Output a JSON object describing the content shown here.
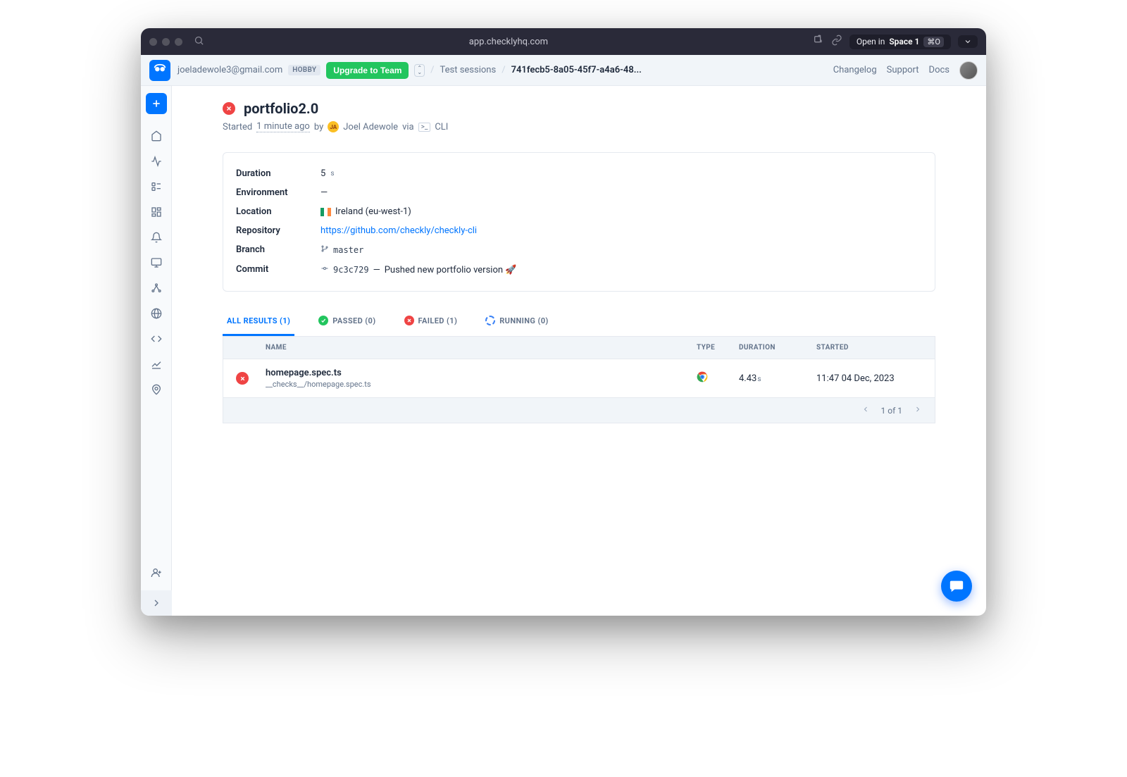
{
  "browser": {
    "url": "app.checklyhq.com",
    "open_in": "Open in",
    "space": "Space 1",
    "shortcut": "⌘O"
  },
  "header": {
    "email": "joeladewole3@gmail.com",
    "plan_badge": "HOBBY",
    "upgrade_label": "Upgrade to Team",
    "crumb_sessions": "Test sessions",
    "crumb_id": "741fecb5-8a05-45f7-a4a6-48...",
    "links": {
      "changelog": "Changelog",
      "support": "Support",
      "docs": "Docs"
    }
  },
  "page": {
    "title": "portfolio2.0",
    "started_prefix": "Started",
    "started_time": "1 minute ago",
    "by": "by",
    "user_initials": "JA",
    "user_name": "Joel Adewole",
    "via": "via",
    "via_tool": "CLI"
  },
  "details": {
    "labels": {
      "duration": "Duration",
      "environment": "Environment",
      "location": "Location",
      "repository": "Repository",
      "branch": "Branch",
      "commit": "Commit"
    },
    "duration_value": "5",
    "duration_unit": "s",
    "environment": "—",
    "location": "Ireland (eu-west-1)",
    "repository": "https://github.com/checkly/checkly-cli",
    "branch": "master",
    "commit_hash": "9c3c729",
    "commit_sep": "—",
    "commit_msg": "Pushed new portfolio version 🚀"
  },
  "tabs": {
    "all": "ALL RESULTS (1)",
    "passed": "PASSED (0)",
    "failed": "FAILED (1)",
    "running": "RUNNING (0)"
  },
  "table": {
    "headers": {
      "name": "NAME",
      "type": "TYPE",
      "duration": "DURATION",
      "started": "STARTED"
    },
    "rows": [
      {
        "name": "homepage.spec.ts",
        "path": "__checks__/homepage.spec.ts",
        "duration_value": "4.43",
        "duration_unit": "s",
        "started": "11:47 04 Dec, 2023"
      }
    ],
    "pagination": "1 of 1"
  }
}
